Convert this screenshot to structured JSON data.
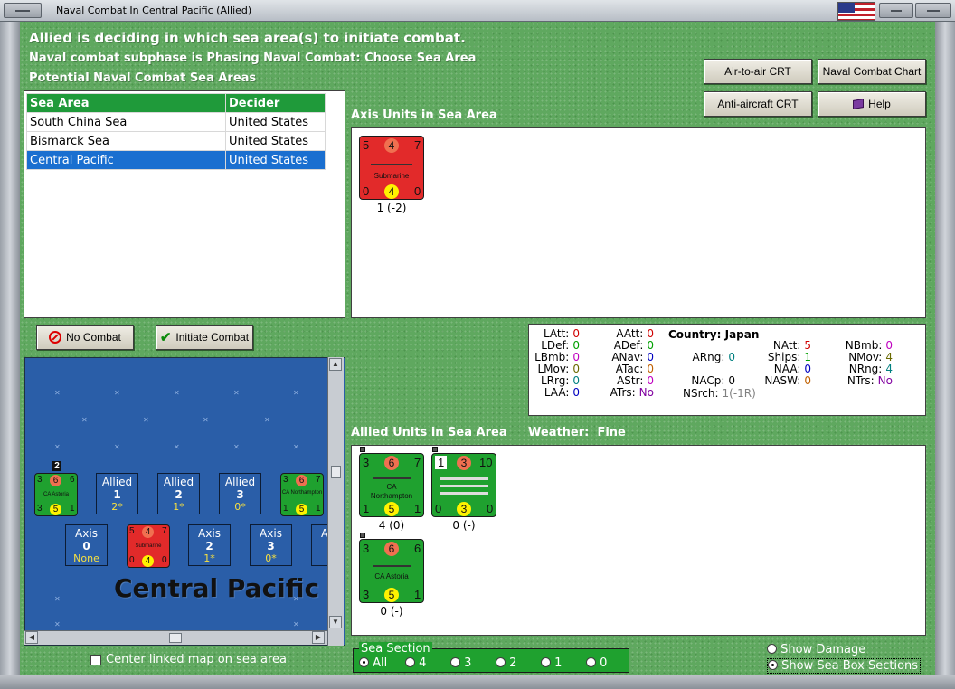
{
  "window": {
    "title": "Naval Combat In Central Pacific (Allied)"
  },
  "header": {
    "line1": "Allied is deciding in which sea area(s) to initiate combat.",
    "line2": "Naval combat subphase is Phasing Naval Combat: Choose Sea Area",
    "line3": "Potential Naval Combat Sea Areas"
  },
  "buttons": {
    "air_to_air": "Air-to-air CRT",
    "naval_chart": "Naval Combat Chart",
    "anti_aircraft": "Anti-aircraft CRT",
    "help": "Help",
    "no_combat": "No Combat",
    "initiate_combat": "Initiate Combat"
  },
  "sea_table": {
    "headers": [
      "Sea Area",
      "Decider"
    ],
    "rows": [
      [
        "South China Sea",
        "United States"
      ],
      [
        "Bismarck Sea",
        "United States"
      ],
      [
        "Central Pacific",
        "United States"
      ]
    ],
    "selected_row": 2
  },
  "axis_panel": {
    "title": "Axis Units in Sea Area",
    "units": [
      {
        "tl": "5",
        "tc": "4",
        "tr": "7",
        "name": "Submarine",
        "bl": "0",
        "bc": "4",
        "br": "0",
        "caption": "1 (-2)"
      }
    ]
  },
  "stats": {
    "country_label": "Country:",
    "country": "Japan",
    "col1": [
      [
        "LAtt:",
        "0"
      ],
      [
        "LDef:",
        "0"
      ],
      [
        "LBmb:",
        "0"
      ],
      [
        "LMov:",
        "0"
      ],
      [
        "LRrg:",
        "0"
      ],
      [
        "LAA:",
        "0"
      ]
    ],
    "col2": [
      [
        "AAtt:",
        "0"
      ],
      [
        "ADef:",
        "0"
      ],
      [
        "ANav:",
        "0"
      ],
      [
        "ATac:",
        "0"
      ],
      [
        "AStr:",
        "0"
      ],
      [
        "ATrs:",
        "No"
      ]
    ],
    "col3": [
      [
        "ARng:",
        "0"
      ],
      [
        "NACp:",
        "0"
      ],
      [
        "NSrch:",
        "1(-1R)"
      ]
    ],
    "col4": [
      [
        "NAtt:",
        "5"
      ],
      [
        "Ships:",
        "1"
      ],
      [
        "NAA:",
        "0"
      ],
      [
        "NASW:",
        "0"
      ]
    ],
    "col5": [
      [
        "NBmb:",
        "0"
      ],
      [
        "NMov:",
        "4"
      ],
      [
        "NRng:",
        "4"
      ],
      [
        "NTrs:",
        "No"
      ]
    ]
  },
  "allied_panel": {
    "title": "Allied Units in Sea Area",
    "weather_label": "Weather:",
    "weather": "Fine",
    "units": [
      {
        "tl": "3",
        "tc": "6",
        "tr": "7",
        "type": "CA",
        "name": "Northampton",
        "bl": "1",
        "bc": "5",
        "br": "1",
        "caption": "4 (0)"
      },
      {
        "tl": "1",
        "tc": "3",
        "tr": "10",
        "type": "",
        "name": "",
        "bl": "0",
        "bc": "3",
        "br": "0",
        "caption": "0 (-)"
      },
      {
        "tl": "3",
        "tc": "6",
        "tr": "6",
        "type": "CA",
        "name": "Astoria",
        "bl": "3",
        "bc": "5",
        "br": "1",
        "caption": "0 (-)"
      }
    ]
  },
  "sea_map": {
    "area_name": "Central Pacific",
    "allied_boxes": [
      {
        "side": "Allied",
        "num": "1",
        "val": "2*"
      },
      {
        "side": "Allied",
        "num": "2",
        "val": "1*"
      },
      {
        "side": "Allied",
        "num": "3",
        "val": "0*"
      }
    ],
    "axis_boxes": [
      {
        "side": "Axis",
        "num": "0",
        "val": "None"
      },
      {
        "side": "Axis",
        "num": "2",
        "val": "1*"
      },
      {
        "side": "Axis",
        "num": "3",
        "val": "0*"
      },
      {
        "side": "A",
        "num": "",
        "val": ""
      }
    ],
    "stack_count": "2",
    "map_units": {
      "astoria": {
        "tl": "3",
        "tc": "6",
        "tr": "6",
        "name": "CA Astoria",
        "bl": "3",
        "bc": "5",
        "br": "1"
      },
      "northampton": {
        "tl": "3",
        "tc": "6",
        "tr": "7",
        "name": "CA Northampton",
        "bl": "1",
        "bc": "5",
        "br": "1"
      },
      "submarine": {
        "tl": "5",
        "tc": "4",
        "tr": "7",
        "name": "Submarine",
        "bl": "0",
        "bc": "4",
        "br": "0"
      }
    }
  },
  "center_map": {
    "label": "Center linked map on sea area",
    "checked": false
  },
  "sea_section": {
    "legend": "Sea Section",
    "options": [
      "All",
      "4",
      "3",
      "2",
      "1",
      "0"
    ],
    "selected": "All"
  },
  "show_damage": {
    "label": "Show Damage",
    "checked": false
  },
  "show_sea_box": {
    "label": "Show Sea Box Sections",
    "checked": true
  },
  "colors": {
    "felt": "#5fa85f",
    "table_header": "#1f9a3a",
    "selection": "#1a6fd0",
    "axis_counter": "#e22a2a",
    "allied_counter": "#1fa12f",
    "sea": "#2a5ea8"
  }
}
